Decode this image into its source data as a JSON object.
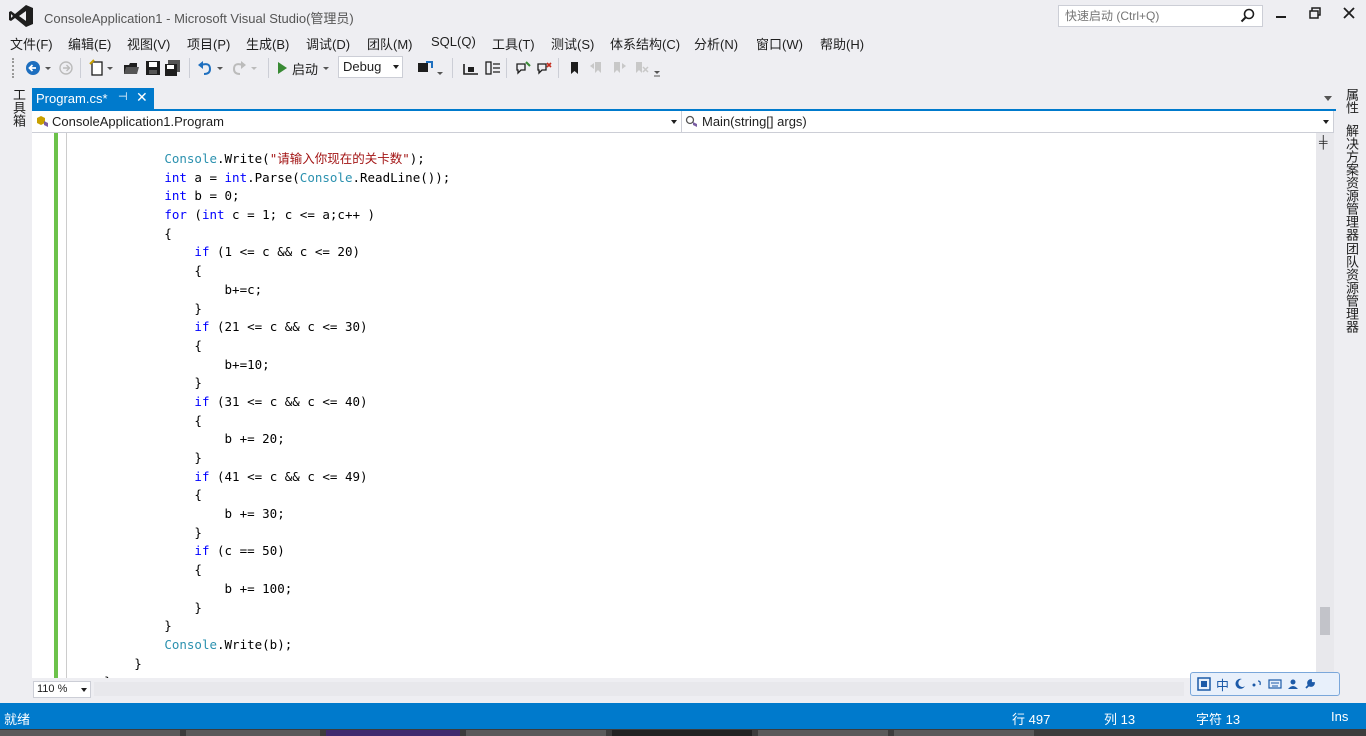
{
  "window": {
    "title": "ConsoleApplication1 - Microsoft Visual Studio(管理员)",
    "quick_launch_placeholder": "快速启动 (Ctrl+Q)"
  },
  "menu": [
    "文件(F)",
    "编辑(E)",
    "视图(V)",
    "项目(P)",
    "生成(B)",
    "调试(D)",
    "团队(M)",
    "SQL(Q)",
    "工具(T)",
    "测试(S)",
    "体系结构(C)",
    "分析(N)",
    "窗口(W)",
    "帮助(H)"
  ],
  "toolbar": {
    "start_label": "启动",
    "config": "Debug"
  },
  "left_rail": {
    "toolbox": "工具箱"
  },
  "right_rail": {
    "properties": "属性",
    "solution_explorer": "解决方案资源管理器",
    "team_explorer": "团队资源管理器"
  },
  "tab": {
    "label": "Program.cs*",
    "pin": "⊣",
    "close": "✕"
  },
  "nav": {
    "class_combo": "ConsoleApplication1.Program",
    "member_combo": "Main(string[] args)"
  },
  "code_lines": [
    "            Console.Write(\"请输入你现在的关卡数\");",
    "            int a = int.Parse(Console.ReadLine());",
    "            int b = 0;",
    "            for (int c = 1; c <= a;c++ )",
    "            {",
    "                if (1 <= c && c <= 20)",
    "                {",
    "                    b+=c;",
    "                }",
    "                if (21 <= c && c <= 30)",
    "                {",
    "                    b+=10;",
    "                }",
    "                if (31 <= c && c <= 40)",
    "                {",
    "                    b += 20;",
    "                }",
    "                if (41 <= c && c <= 49)",
    "                {",
    "                    b += 30;",
    "                }",
    "                if (c == 50)",
    "                {",
    "                    b += 100;",
    "                }",
    "            }",
    "            Console.Write(b);",
    "        }",
    "    }"
  ],
  "zoom": "110 %",
  "ime": [
    "中"
  ],
  "status": {
    "ready": "就绪",
    "line": "行 497",
    "col": "列 13",
    "char": "字符 13",
    "mode": "Ins"
  },
  "colors": {
    "accent": "#007acc",
    "keyword": "#0000ff",
    "type": "#2b91af",
    "string": "#a31515",
    "change_margin": "#6cc24a"
  }
}
